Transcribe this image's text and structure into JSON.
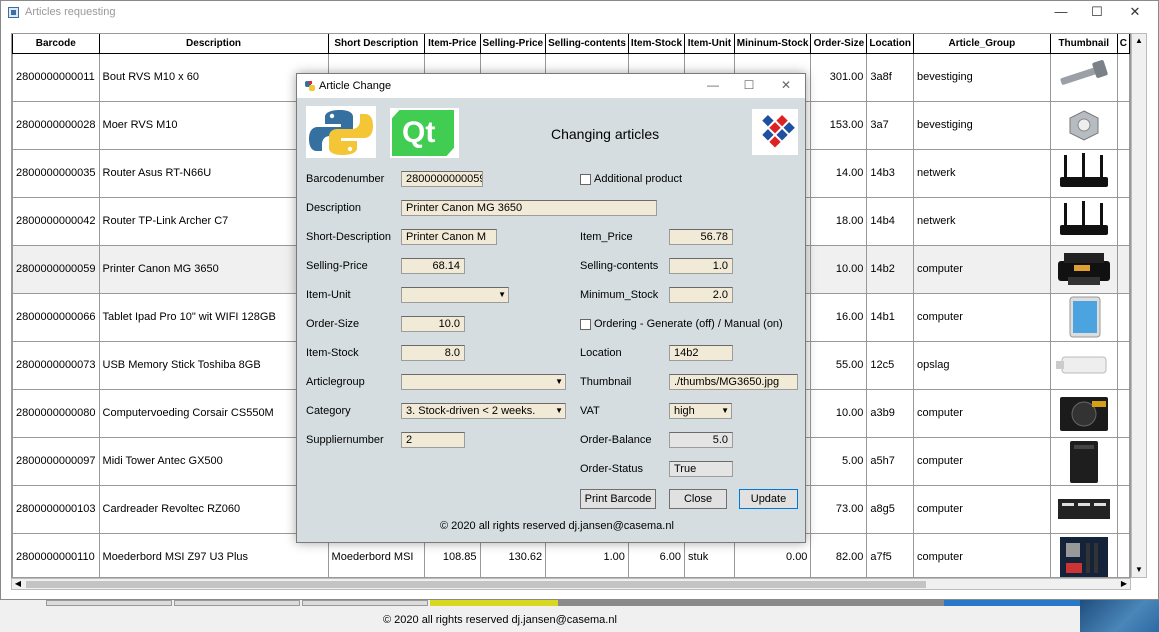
{
  "window": {
    "title": "Articles requesting",
    "minimize": "—",
    "maximize": "☐",
    "close": "✕"
  },
  "table": {
    "headers": [
      "Barcode",
      "Description",
      "Short Description",
      "Item-Price",
      "Selling-Price",
      "Selling-contents",
      "Item-Stock",
      "Item-Unit",
      "Mininum-Stock",
      "Order-Size",
      "Location",
      "Article_Group",
      "Thumbnail",
      "C"
    ],
    "rows": [
      {
        "barcode": "2800000000011",
        "description": "Bout RVS M10 x 60",
        "short": "",
        "item_price": "",
        "selling_price": "",
        "selling_contents": "",
        "item_stock": "",
        "item_unit": "",
        "min_stock": "",
        "order_size": "301.00",
        "location": "3a8f",
        "group": "bevestiging",
        "thumb": "bolt"
      },
      {
        "barcode": "2800000000028",
        "description": "Moer RVS M10",
        "short": "",
        "item_price": "",
        "selling_price": "",
        "selling_contents": "",
        "item_stock": "",
        "item_unit": "",
        "min_stock": "",
        "order_size": "153.00",
        "location": "3a7",
        "group": "bevestiging",
        "thumb": "nut"
      },
      {
        "barcode": "2800000000035",
        "description": "Router Asus RT-N66U",
        "short": "",
        "item_price": "",
        "selling_price": "",
        "selling_contents": "",
        "item_stock": "",
        "item_unit": "",
        "min_stock": "",
        "order_size": "14.00",
        "location": "14b3",
        "group": "netwerk",
        "thumb": "router"
      },
      {
        "barcode": "2800000000042",
        "description": "Router TP-Link Archer C7",
        "short": "",
        "item_price": "",
        "selling_price": "",
        "selling_contents": "",
        "item_stock": "",
        "item_unit": "",
        "min_stock": "",
        "order_size": "18.00",
        "location": "14b4",
        "group": "netwerk",
        "thumb": "router"
      },
      {
        "barcode": "2800000000059",
        "description": "Printer Canon MG 3650",
        "short": "",
        "item_price": "",
        "selling_price": "",
        "selling_contents": "",
        "item_stock": "",
        "item_unit": "",
        "min_stock": "",
        "order_size": "10.00",
        "location": "14b2",
        "group": "computer",
        "thumb": "printer"
      },
      {
        "barcode": "2800000000066",
        "description": "Tablet Ipad Pro 10\" wit WIFI 128GB",
        "short": "",
        "item_price": "",
        "selling_price": "",
        "selling_contents": "",
        "item_stock": "",
        "item_unit": "",
        "min_stock": "",
        "order_size": "16.00",
        "location": "14b1",
        "group": "computer",
        "thumb": "tablet"
      },
      {
        "barcode": "2800000000073",
        "description": "USB Memory Stick Toshiba 8GB",
        "short": "",
        "item_price": "",
        "selling_price": "",
        "selling_contents": "",
        "item_stock": "",
        "item_unit": "",
        "min_stock": "",
        "order_size": "55.00",
        "location": "12c5",
        "group": "opslag",
        "thumb": "usb"
      },
      {
        "barcode": "2800000000080",
        "description": "Computervoeding Corsair CS550M",
        "short": "",
        "item_price": "",
        "selling_price": "",
        "selling_contents": "",
        "item_stock": "",
        "item_unit": "",
        "min_stock": "",
        "order_size": "10.00",
        "location": "a3b9",
        "group": "computer",
        "thumb": "psu"
      },
      {
        "barcode": "2800000000097",
        "description": "Midi Tower Antec GX500",
        "short": "",
        "item_price": "",
        "selling_price": "",
        "selling_contents": "",
        "item_stock": "",
        "item_unit": "",
        "min_stock": "",
        "order_size": "5.00",
        "location": "a5h7",
        "group": "computer",
        "thumb": "tower"
      },
      {
        "barcode": "2800000000103",
        "description": "Cardreader Revoltec RZ060",
        "short": "",
        "item_price": "",
        "selling_price": "",
        "selling_contents": "",
        "item_stock": "",
        "item_unit": "",
        "min_stock": "",
        "order_size": "73.00",
        "location": "a8g5",
        "group": "computer",
        "thumb": "cardreader"
      },
      {
        "barcode": "2800000000110",
        "description": "Moederbord MSI Z97 U3 Plus",
        "short": "Moederbord MSI",
        "item_price": "108.85",
        "selling_price": "130.62",
        "selling_contents": "1.00",
        "item_stock": "6.00",
        "item_unit": "stuk",
        "min_stock": "0.00",
        "order_size": "82.00",
        "location": "a7f5",
        "group": "computer",
        "thumb": "motherboard"
      }
    ]
  },
  "footer": {
    "text": "© 2020 all rights reserved dj.jansen@casema.nl"
  },
  "dialog": {
    "title": "Article Change",
    "heading": "Changing articles",
    "logos": [
      "python-logo",
      "qt-logo",
      "casema-logo"
    ],
    "qt_text": "Qt",
    "fields": {
      "barcodenumber_label": "Barcodenumber",
      "barcodenumber": "2800000000059",
      "additional_product_label": "Additional product",
      "description_label": "Description",
      "description": "Printer Canon MG 3650",
      "short_description_label": "Short-Description",
      "short_description": "Printer Canon M",
      "item_price_label": "Item_Price",
      "item_price": "56.78",
      "selling_price_label": "Selling-Price",
      "selling_price": "68.14",
      "selling_contents_label": "Selling-contents",
      "selling_contents": "1.0",
      "item_unit_label": "Item-Unit",
      "item_unit": "",
      "minimum_stock_label": "Minimum_Stock",
      "minimum_stock": "2.0",
      "order_size_label": "Order-Size",
      "order_size": "10.0",
      "ordering_label": "Ordering - Generate (off) / Manual (on)",
      "item_stock_label": "Item-Stock",
      "item_stock": "8.0",
      "location_label": "Location",
      "location": "14b2",
      "articlegroup_label": "Articlegroup",
      "articlegroup": "",
      "thumbnail_label": "Thumbnail",
      "thumbnail": "./thumbs/MG3650.jpg",
      "category_label": "Category",
      "category": "3. Stock-driven < 2 weeks.",
      "vat_label": "VAT",
      "vat": "high",
      "suppliernumber_label": "Suppliernumber",
      "suppliernumber": "2",
      "order_balance_label": "Order-Balance",
      "order_balance": "5.0",
      "order_status_label": "Order-Status",
      "order_status": "True"
    },
    "buttons": {
      "print_barcode": "Print Barcode",
      "close": "Close",
      "update": "Update"
    },
    "footer": "© 2020 all rights reserved dj.jansen@casema.nl"
  }
}
